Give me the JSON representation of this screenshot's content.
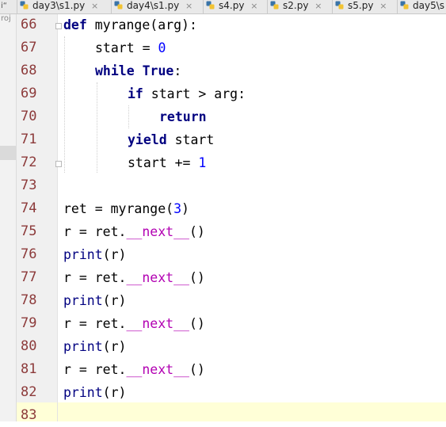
{
  "tabs": {
    "edge_text": "i“",
    "items": [
      {
        "label": "day3\\s1.py",
        "close": "×"
      },
      {
        "label": "day4\\s1.py",
        "close": "×"
      },
      {
        "label": "s4.py",
        "close": "×"
      },
      {
        "label": "s2.py",
        "close": "×"
      },
      {
        "label": "s5.py",
        "close": "×"
      },
      {
        "label": "day5\\s",
        "close": ""
      }
    ]
  },
  "project_strip": {
    "label": "roj"
  },
  "editor": {
    "line_numbers": [
      "66",
      "67",
      "68",
      "69",
      "70",
      "71",
      "72",
      "73",
      "74",
      "75",
      "76",
      "77",
      "78",
      "79",
      "80",
      "81",
      "82",
      "83"
    ],
    "current_line": "83",
    "code": {
      "l66": {
        "kw": "def",
        "rest": " myrange(arg):"
      },
      "l67": {
        "a": "start = ",
        "num": "0"
      },
      "l68": {
        "kw": "while",
        "sp": " ",
        "kw2": "True",
        "rest": ":"
      },
      "l69": {
        "kw": "if",
        "rest": " start > arg:"
      },
      "l70": {
        "kw": "return"
      },
      "l71": {
        "kw": "yield",
        "rest": " start"
      },
      "l72": {
        "a": "start += ",
        "num": "1"
      },
      "l74": {
        "a": "ret = myrange(",
        "num": "3",
        "b": ")"
      },
      "next_call": {
        "a": "r = ret.",
        "dunder": "__next__",
        "b": "()"
      },
      "print_call": {
        "fn": "print",
        "b": "(r)"
      }
    }
  },
  "colors": {
    "keyword": "#000080",
    "number": "#0000ff",
    "dunder": "#b200b2",
    "line_number": "#8c3a3a",
    "current_line_bg": "#ffffd7",
    "gutter_bg": "#f0f0f0"
  },
  "icons": [
    "python-file-icon",
    "fold-marker-icon"
  ]
}
